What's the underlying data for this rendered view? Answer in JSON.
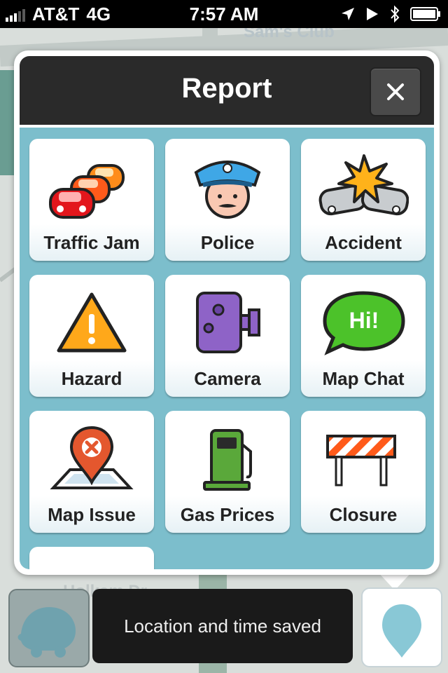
{
  "status_bar": {
    "carrier": "AT&T",
    "network": "4G",
    "time": "7:57 AM"
  },
  "map": {
    "labels": [
      "Sam's Club",
      "Holkam Dr"
    ]
  },
  "report": {
    "title": "Report",
    "items": [
      {
        "label": "Traffic Jam",
        "icon": "traffic-jam-icon"
      },
      {
        "label": "Police",
        "icon": "police-icon"
      },
      {
        "label": "Accident",
        "icon": "accident-icon"
      },
      {
        "label": "Hazard",
        "icon": "hazard-icon"
      },
      {
        "label": "Camera",
        "icon": "camera-icon"
      },
      {
        "label": "Map Chat",
        "icon": "map-chat-icon"
      },
      {
        "label": "Map Issue",
        "icon": "map-issue-icon"
      },
      {
        "label": "Gas Prices",
        "icon": "gas-prices-icon"
      },
      {
        "label": "Closure",
        "icon": "closure-icon"
      }
    ],
    "map_chat_text": "Hi!"
  },
  "toast": {
    "message": "Location and time saved"
  },
  "colors": {
    "accent": "#7cbecc",
    "header": "#2a2a2a"
  }
}
